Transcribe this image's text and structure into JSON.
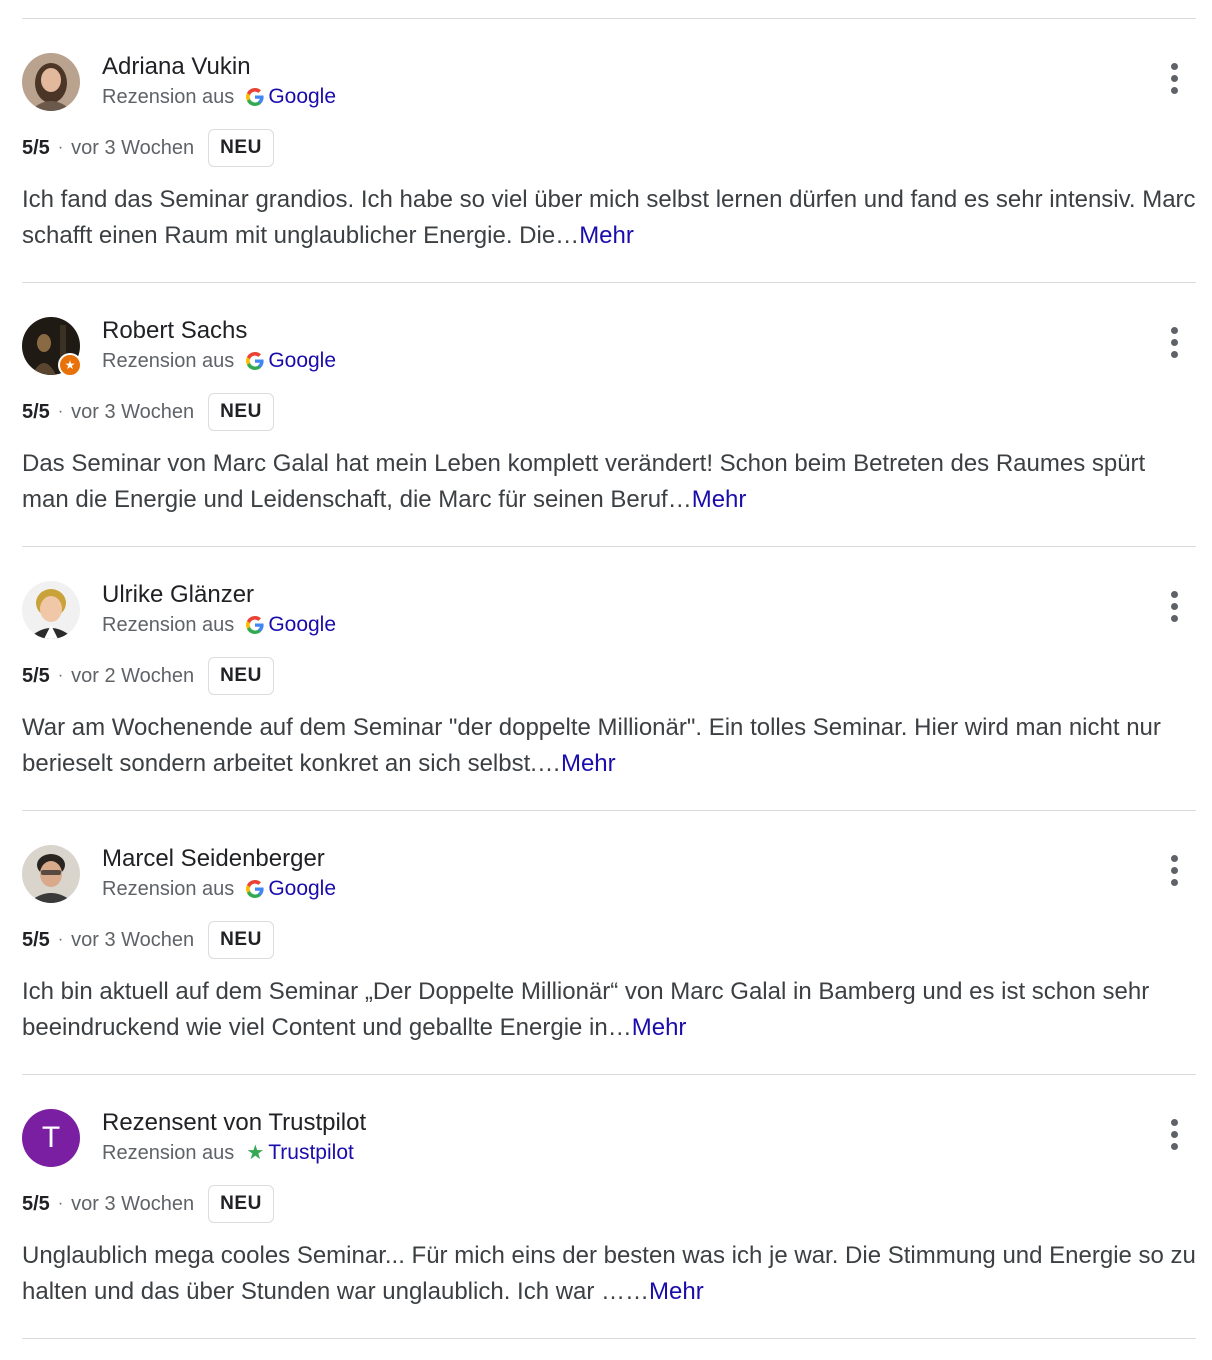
{
  "reviews": [
    {
      "name": "Adriana Vukin",
      "source_prefix": "Rezension aus",
      "source_name": "Google",
      "source_icon": "google-g-icon",
      "rating": "5/5",
      "separator": "·",
      "date": "vor 3 Wochen",
      "badge": "NEU",
      "text": "Ich fand das Seminar grandios. Ich habe so viel über mich selbst lernen dürfen und fand es sehr intensiv. Marc schafft einen Raum mit unglaublicher Energie. Die…",
      "more": "Mehr"
    },
    {
      "name": "Robert Sachs",
      "source_prefix": "Rezension aus",
      "source_name": "Google",
      "source_icon": "google-g-icon",
      "rating": "5/5",
      "separator": "·",
      "date": "vor 3 Wochen",
      "badge": "NEU",
      "text": "Das Seminar von Marc Galal hat mein Leben komplett verändert! Schon beim Betreten des Raumes spürt man die Energie und Leidenschaft, die Marc für seinen Beruf…",
      "more": "Mehr"
    },
    {
      "name": "Ulrike Glänzer",
      "source_prefix": "Rezension aus",
      "source_name": "Google",
      "source_icon": "google-g-icon",
      "rating": "5/5",
      "separator": "·",
      "date": "vor 2 Wochen",
      "badge": "NEU",
      "text": "War am Wochenende auf dem Seminar \"der doppelte Millionär\". Ein tolles Seminar. Hier wird man nicht nur berieselt sondern arbeitet konkret an sich selbst.…",
      "more": "Mehr"
    },
    {
      "name": "Marcel Seidenberger",
      "source_prefix": "Rezension aus",
      "source_name": "Google",
      "source_icon": "google-g-icon",
      "rating": "5/5",
      "separator": "·",
      "date": "vor 3 Wochen",
      "badge": "NEU",
      "text": "Ich bin aktuell auf dem Seminar „Der Doppelte Millionär“ von Marc Galal in Bamberg und es ist schon sehr beeindruckend wie viel Content und geballte Energie in…",
      "more": "Mehr"
    },
    {
      "name": "Rezensent von Trustpilot",
      "avatar_letter": "T",
      "source_prefix": "Rezension aus",
      "source_name": "Trustpilot",
      "source_icon": "trustpilot-star-icon",
      "rating": "5/5",
      "separator": "·",
      "date": "vor 3 Wochen",
      "badge": "NEU",
      "text": "Unglaublich mega cooles Seminar... Für mich eins der besten was ich je war. Die Stimmung und Energie so zu halten und das über Stunden war unglaublich. Ich war ……",
      "more": "Mehr"
    }
  ],
  "colors": {
    "link": "#1a0dab",
    "muted": "#5f6368",
    "divider": "#dadce0",
    "trustpilot_avatar": "#7b1fa2",
    "trustpilot_star": "#34a853",
    "local_guide_badge": "#e8710a"
  }
}
